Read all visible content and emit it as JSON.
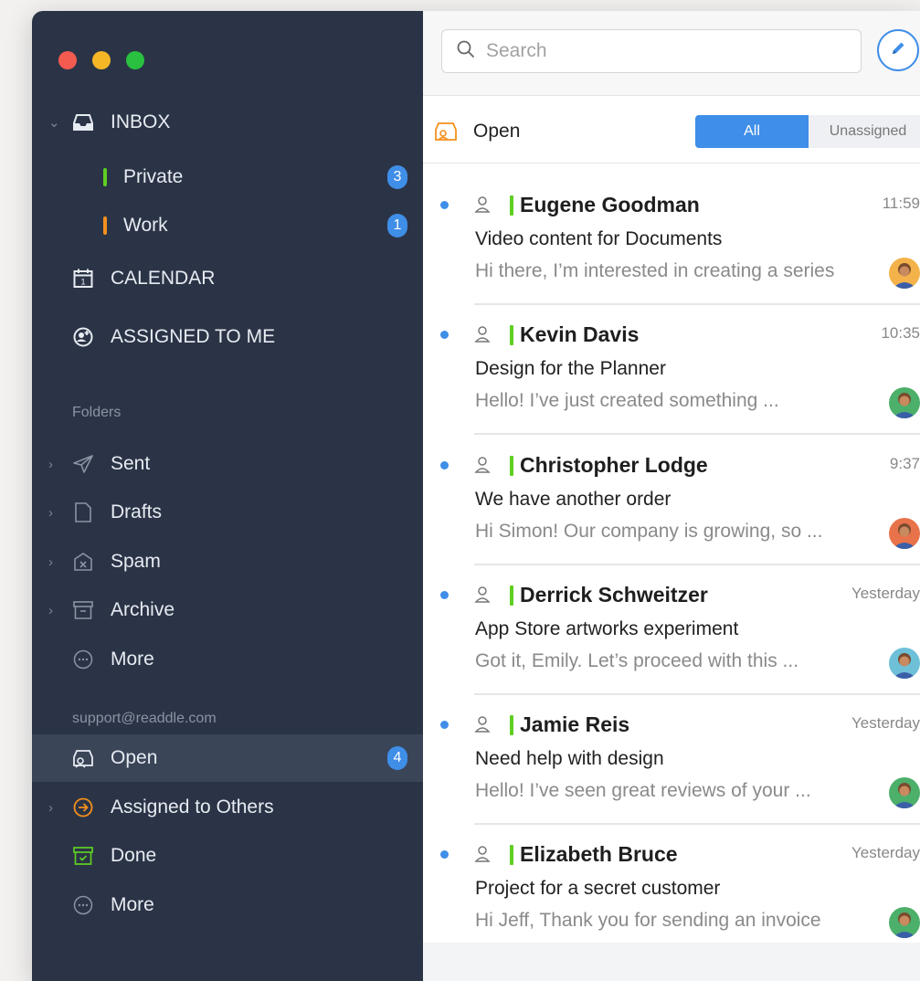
{
  "sidebar": {
    "inbox": "INBOX",
    "private": {
      "label": "Private",
      "count": "3",
      "color": "#5fcf22"
    },
    "work": {
      "label": "Work",
      "count": "1",
      "color": "#f5901e"
    },
    "calendar": "CALENDAR",
    "assigned_to_me": "ASSIGNED TO ME",
    "folders_title": "Folders",
    "folders": [
      "Sent",
      "Drafts",
      "Spam",
      "Archive",
      "More"
    ],
    "account": "support@readdle.com",
    "account_items": {
      "open": {
        "label": "Open",
        "count": "4"
      },
      "assigned_to_others": "Assigned to Others",
      "done": "Done",
      "more": "More"
    }
  },
  "search": {
    "placeholder": "Search"
  },
  "list": {
    "title": "Open",
    "segments": {
      "all": "All",
      "unassigned": "Unassigned"
    },
    "messages": [
      {
        "sender": "Eugene Goodman",
        "time": "11:59",
        "subject": "Video content for Documents",
        "preview": "Hi there, I’m interested in creating a series",
        "avatar_color": "#f3b34a"
      },
      {
        "sender": "Kevin Davis",
        "time": "10:35",
        "subject": "Design for the Planner",
        "preview": "Hello! I’ve just created something ...",
        "avatar_color": "#4caf6a"
      },
      {
        "sender": "Christopher Lodge",
        "time": "9:37",
        "subject": "We have another order",
        "preview": "Hi Simon! Our company is growing, so ...",
        "avatar_color": "#e8734a"
      },
      {
        "sender": "Derrick Schweitzer",
        "time": "Yesterday",
        "subject": "App Store artworks experiment",
        "preview": "Got it, Emily. Let’s proceed with this ...",
        "avatar_color": "#6ec0d8"
      },
      {
        "sender": "Jamie Reis",
        "time": "Yesterday",
        "subject": "Need help with design",
        "preview": "Hello! I’ve seen great reviews of your ...",
        "avatar_color": "#4caf6a"
      },
      {
        "sender": "Elizabeth Bruce",
        "time": "Yesterday",
        "subject": "Project for a secret customer",
        "preview": "Hi Jeff, Thank you for sending an invoice",
        "avatar_color": "#4caf6a"
      }
    ]
  },
  "colors": {
    "accent": "#3f8ee8",
    "sidebar": "#2b3446",
    "open_icon": "#f5901e",
    "done_icon": "#5fcf22"
  }
}
